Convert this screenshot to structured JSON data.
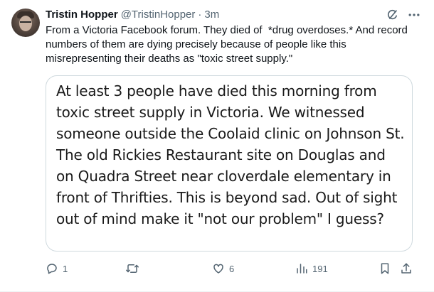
{
  "tweet": {
    "author_name": "Tristin Hopper",
    "author_handle": "@TristinHopper",
    "separator": "·",
    "time": "3m",
    "text": "From a Victoria Facebook forum. They died of  *drug overdoses.* And record numbers of them are dying precisely because of people like this misrepresenting their deaths as \"toxic street supply.\"",
    "media_text": "At least 3 people have died this morning from toxic street supply in Victoria. We witnessed someone outside the Coolaid clinic on Johnson St. The old Rickies Restaurant site on Douglas and on Quadra Street near cloverdale elementary in front of Thrifties. This is beyond sad. Out of sight out of mind make it \"not our problem\" I guess?"
  },
  "actions": {
    "replies": "1",
    "retweets": "",
    "likes": "6",
    "views": "191"
  },
  "icons": {
    "top": [
      "grok-icon",
      "more-icon"
    ],
    "actions": [
      "reply-icon",
      "retweet-icon",
      "like-icon",
      "views-icon",
      "bookmark-icon",
      "share-icon"
    ]
  },
  "colors": {
    "text": "#0f1419",
    "secondary": "#536471",
    "border": "#cfd9de"
  }
}
